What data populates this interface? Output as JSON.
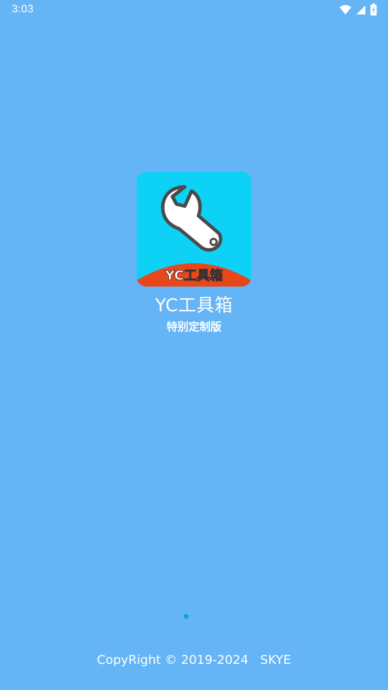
{
  "status_bar": {
    "time": "3:03",
    "icons": [
      "wifi-icon",
      "signal-icon",
      "battery-icon"
    ]
  },
  "splash": {
    "logo_icon": "wrench-icon",
    "logo_text": "YC工具箱",
    "app_name": "YC工具箱",
    "edition": "特别定制版",
    "copyright": "CopyRight © 2019-2024   SKYE"
  },
  "colors": {
    "background": "#64b4f6",
    "logo_background": "#0dd1f5",
    "logo_banner": "#e8461b",
    "loading_indicator": "#0a9fd6"
  }
}
